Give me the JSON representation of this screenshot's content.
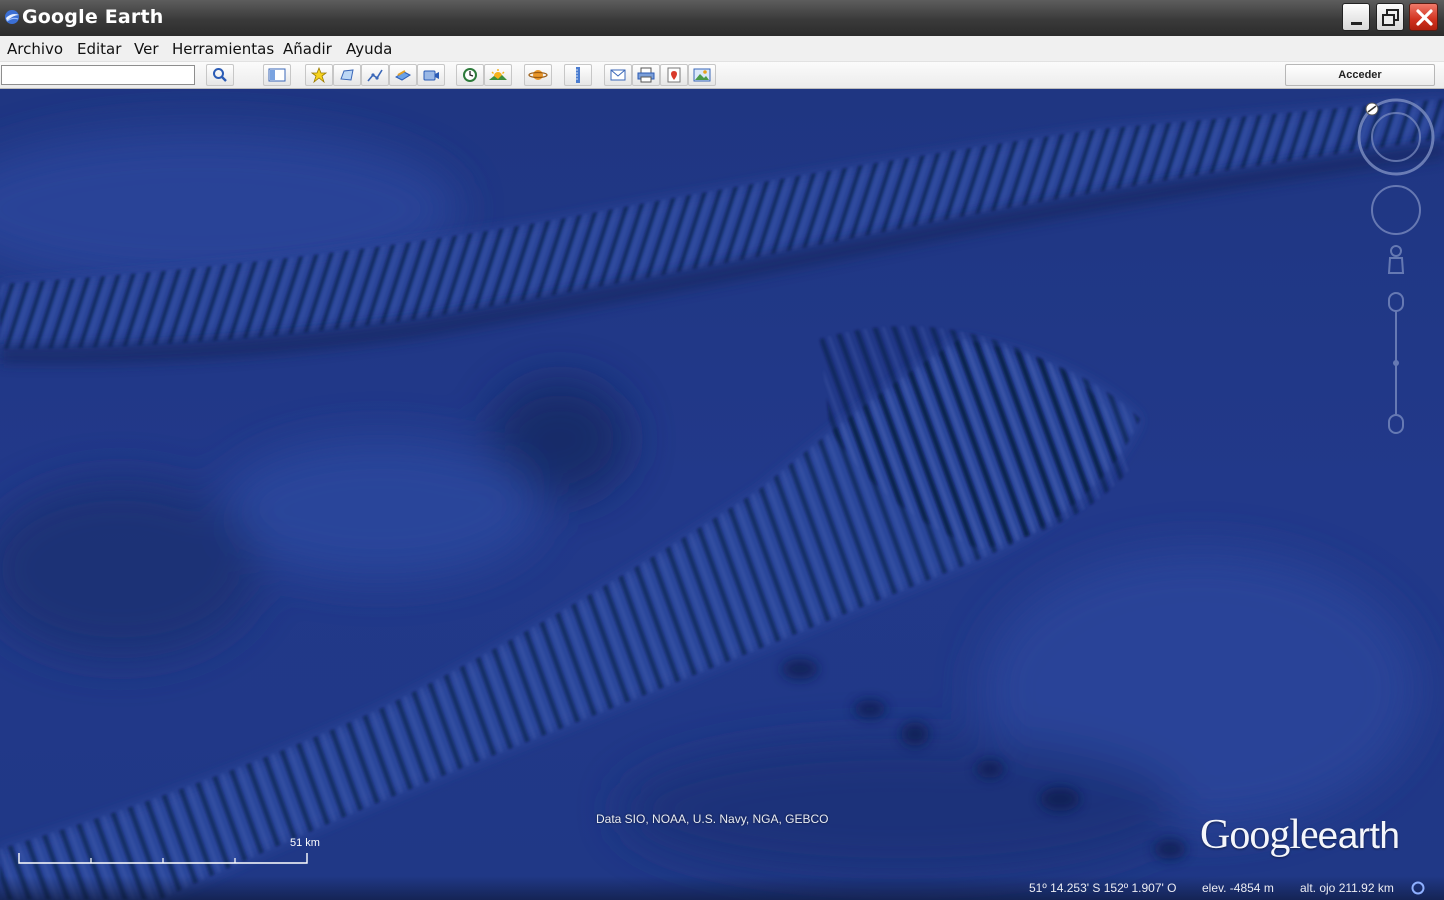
{
  "window": {
    "title": "Google Earth"
  },
  "menu": {
    "items": [
      {
        "label": "Archivo"
      },
      {
        "label": "Editar"
      },
      {
        "label": "Ver"
      },
      {
        "label": "Herramientas"
      },
      {
        "label": "Añadir"
      },
      {
        "label": "Ayuda"
      }
    ]
  },
  "toolbar": {
    "search_value": "",
    "signin_label": "Acceder",
    "icons": [
      "search-icon",
      "sidebar-toggle-icon",
      "add-placemark-icon",
      "add-polygon-icon",
      "add-path-icon",
      "add-image-overlay-icon",
      "record-tour-icon",
      "historical-imagery-icon",
      "sunlight-icon",
      "planets-icon",
      "ruler-icon",
      "email-icon",
      "print-icon",
      "view-in-maps-icon",
      "save-image-icon"
    ]
  },
  "map": {
    "attribution": "Data SIO, NOAA, U.S. Navy, NGA, GEBCO",
    "scale_label": "51 km",
    "logo_google": "Google",
    "logo_earth": "earth"
  },
  "status": {
    "coordinates": "51º 14.253' S  152º 1.907' O",
    "elevation": "elev. -4854 m",
    "eye_altitude": "alt. ojo 211.92 km"
  },
  "colors": {
    "ocean": "#233a86",
    "titlebar": "#3a3a3a",
    "close_button": "#d1321f"
  }
}
